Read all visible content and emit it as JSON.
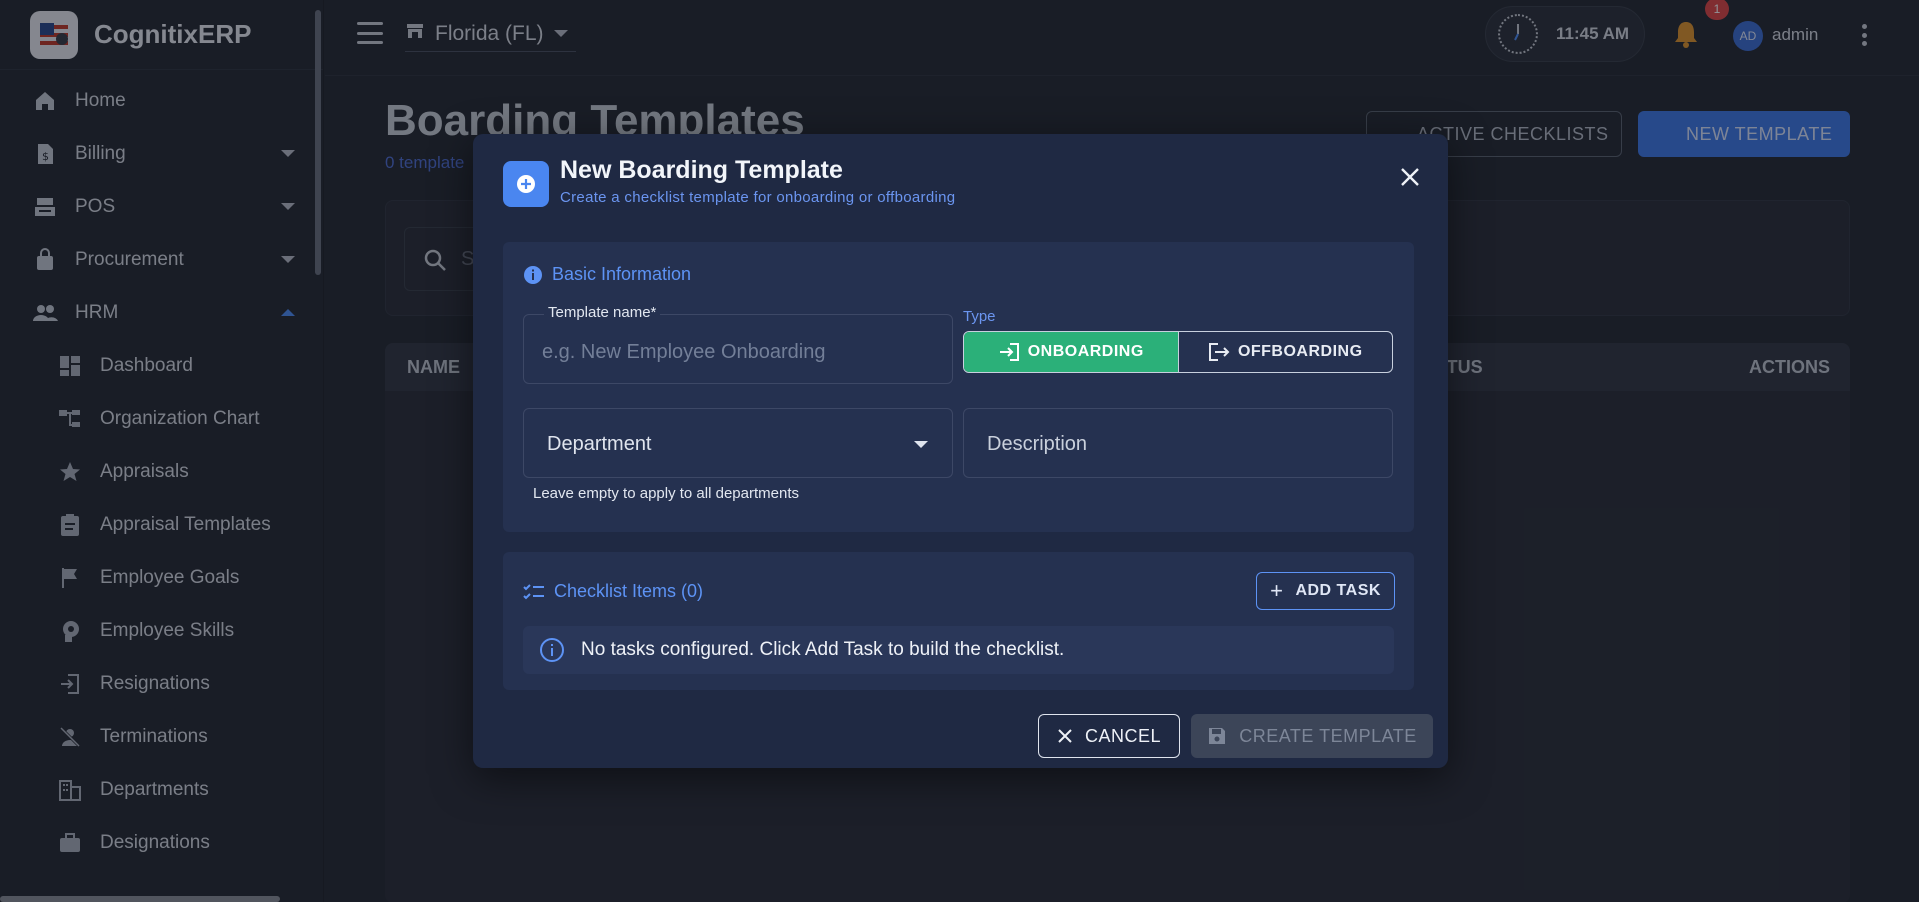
{
  "app": {
    "brand": "CognitixERP",
    "store": "Florida (FL)",
    "time": "11:45 AM",
    "notification_count": "1",
    "avatar_initials": "AD",
    "username": "admin"
  },
  "sidebar": {
    "items": [
      {
        "label": "Home",
        "icon": "home-icon"
      },
      {
        "label": "Billing",
        "icon": "billing-icon",
        "caret": "down"
      },
      {
        "label": "POS",
        "icon": "pos-icon",
        "caret": "down"
      },
      {
        "label": "Procurement",
        "icon": "bag-icon",
        "caret": "down"
      },
      {
        "label": "HRM",
        "icon": "people-icon",
        "caret": "up"
      }
    ],
    "sub_items": [
      {
        "label": "Dashboard",
        "icon": "dashboard-icon"
      },
      {
        "label": "Organization Chart",
        "icon": "org-chart-icon"
      },
      {
        "label": "Appraisals",
        "icon": "star-icon"
      },
      {
        "label": "Appraisal Templates",
        "icon": "clipboard-icon"
      },
      {
        "label": "Employee Goals",
        "icon": "flag-icon"
      },
      {
        "label": "Employee Skills",
        "icon": "skill-icon"
      },
      {
        "label": "Resignations",
        "icon": "exit-icon"
      },
      {
        "label": "Terminations",
        "icon": "person-off-icon"
      },
      {
        "label": "Departments",
        "icon": "building-icon"
      },
      {
        "label": "Designations",
        "icon": "briefcase-icon"
      }
    ]
  },
  "page": {
    "title": "Boarding Templates",
    "subtitle": "0 template",
    "active_checklists_label": "ACTIVE CHECKLISTS",
    "new_template_label": "NEW TEMPLATE",
    "search_partial": "S",
    "table_headers": {
      "name": "NAME",
      "status": "ATUS",
      "actions": "ACTIONS"
    }
  },
  "modal": {
    "title": "New Boarding Template",
    "subtitle": "Create a checklist template for onboarding or offboarding",
    "basic_section_title": "Basic Information",
    "template_name_label": "Template name*",
    "template_name_placeholder": "e.g. New Employee Onboarding",
    "type_label": "Type",
    "type_options": [
      "ONBOARDING",
      "OFFBOARDING"
    ],
    "type_selected": "ONBOARDING",
    "department_label": "Department",
    "description_label": "Description",
    "department_helper": "Leave empty to apply to all departments",
    "checklist_title": "Checklist Items (0)",
    "add_task_label": "ADD TASK",
    "empty_message": "No tasks configured. Click Add Task to build the checklist.",
    "cancel_label": "CANCEL",
    "create_label": "CREATE TEMPLATE"
  },
  "colors": {
    "accent": "#4a86f0",
    "onboarding_active": "#2bb079",
    "modal_bg": "#1f2943"
  }
}
